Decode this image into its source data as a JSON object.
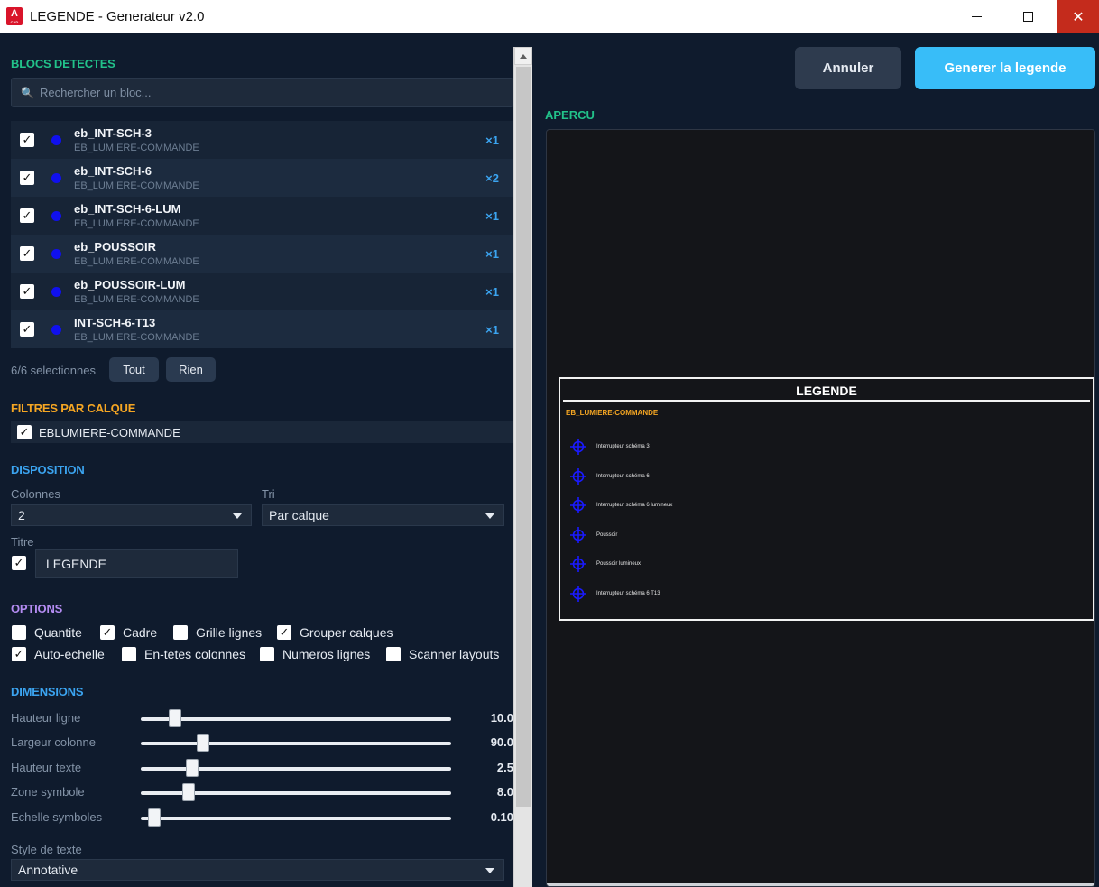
{
  "window": {
    "title": "LEGENDE - Generateur v2.0",
    "app_icon_letter": "A",
    "app_icon_sub": "CAD",
    "close_glyph": "✕"
  },
  "blocks_section": {
    "title": "BLOCS DETECTES",
    "search_placeholder": "Rechercher un bloc...",
    "search_icon": "🔍",
    "items": [
      {
        "name": "eb_INT-SCH-3",
        "layer": "EB_LUMIERE-COMMANDE",
        "count": "×1",
        "checked": true
      },
      {
        "name": "eb_INT-SCH-6",
        "layer": "EB_LUMIERE-COMMANDE",
        "count": "×2",
        "checked": true
      },
      {
        "name": "eb_INT-SCH-6-LUM",
        "layer": "EB_LUMIERE-COMMANDE",
        "count": "×1",
        "checked": true
      },
      {
        "name": "eb_POUSSOIR",
        "layer": "EB_LUMIERE-COMMANDE",
        "count": "×1",
        "checked": true
      },
      {
        "name": "eb_POUSSOIR-LUM",
        "layer": "EB_LUMIERE-COMMANDE",
        "count": "×1",
        "checked": true
      },
      {
        "name": "INT-SCH-6-T13",
        "layer": "EB_LUMIERE-COMMANDE",
        "count": "×1",
        "checked": true
      }
    ],
    "selection_count": "6/6 selectionnes",
    "all_label": "Tout",
    "none_label": "Rien",
    "dot_color": "#1010ee"
  },
  "layer_filters": {
    "title": "FILTRES PAR CALQUE",
    "items": [
      {
        "label": "EBLUMIERE-COMMANDE",
        "checked": true
      }
    ]
  },
  "layout": {
    "title": "DISPOSITION",
    "columns_label": "Colonnes",
    "columns_value": "2",
    "sort_label": "Tri",
    "sort_value": "Par calque",
    "title_label": "Titre",
    "title_value": "LEGENDE",
    "title_checked": true
  },
  "options": {
    "title": "OPTIONS",
    "items": [
      {
        "label": "Quantite",
        "checked": false
      },
      {
        "label": "Cadre",
        "checked": true
      },
      {
        "label": "Grille lignes",
        "checked": false
      },
      {
        "label": "Grouper calques",
        "checked": true
      },
      {
        "label": "Auto-echelle",
        "checked": true
      },
      {
        "label": "En-tetes colonnes",
        "checked": false
      },
      {
        "label": "Numeros lignes",
        "checked": false
      },
      {
        "label": "Scanner layouts",
        "checked": false
      }
    ]
  },
  "dimensions": {
    "title": "DIMENSIONS",
    "sliders": [
      {
        "label": "Hauteur ligne",
        "value": "10.0",
        "fraction": 0.11
      },
      {
        "label": "Largeur colonne",
        "value": "90.0",
        "fraction": 0.2
      },
      {
        "label": "Hauteur texte",
        "value": "2.5",
        "fraction": 0.165
      },
      {
        "label": "Zone symbole",
        "value": "8.0",
        "fraction": 0.154
      },
      {
        "label": "Echelle symboles",
        "value": "0.10",
        "fraction": 0.045
      }
    ],
    "text_style_label": "Style de texte",
    "text_style_value": "Annotative"
  },
  "actions": {
    "cancel_label": "Annuler",
    "generate_label": "Generer la legende"
  },
  "preview": {
    "title": "APERCU",
    "legend_title": "LEGENDE",
    "layer_heading": "EB_LUMIERE-COMMANDE",
    "items": [
      "Interrupteur schéma 3",
      "Interrupteur schéma 6",
      "Interrupteur schéma 6 lumineux",
      "Poussoir",
      "Poussoir lumineux",
      "Interrupteur schéma 6 T13"
    ],
    "symbol_color": "#1a1aff",
    "layer_color": "#f5a623"
  },
  "colors": {
    "background": "#0f1b2d",
    "accent_green": "#22c28a",
    "accent_orange": "#f5a623",
    "accent_blue": "#3ba4f0",
    "accent_purple": "#b48cf2",
    "primary_button": "#38bdf8"
  }
}
